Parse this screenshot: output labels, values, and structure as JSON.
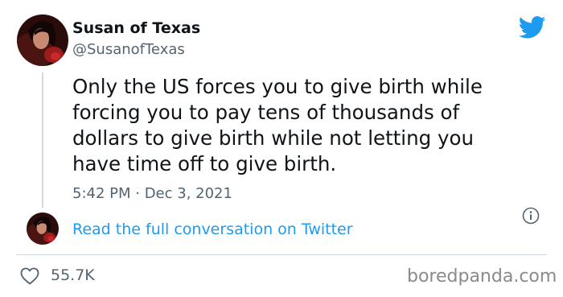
{
  "tweet": {
    "display_name": "Susan of Texas",
    "handle": "@SusanofTexas",
    "text": "Only the US forces you to give birth while forcing you to pay tens of thousands of dollars to give birth while not letting you have time off to give birth.",
    "timestamp": "5:42 PM · Dec 3, 2021",
    "read_conversation_label": "Read the full conversation on Twitter",
    "likes": "55.7K"
  },
  "icons": {
    "brand": "twitter-bird-icon",
    "info": "info-icon",
    "like": "heart-icon"
  },
  "colors": {
    "brand_blue": "#1d9bf0",
    "text_primary": "#0f1419",
    "text_secondary": "#536471",
    "divider": "#cfd9de"
  },
  "watermark": "boredpanda.com"
}
